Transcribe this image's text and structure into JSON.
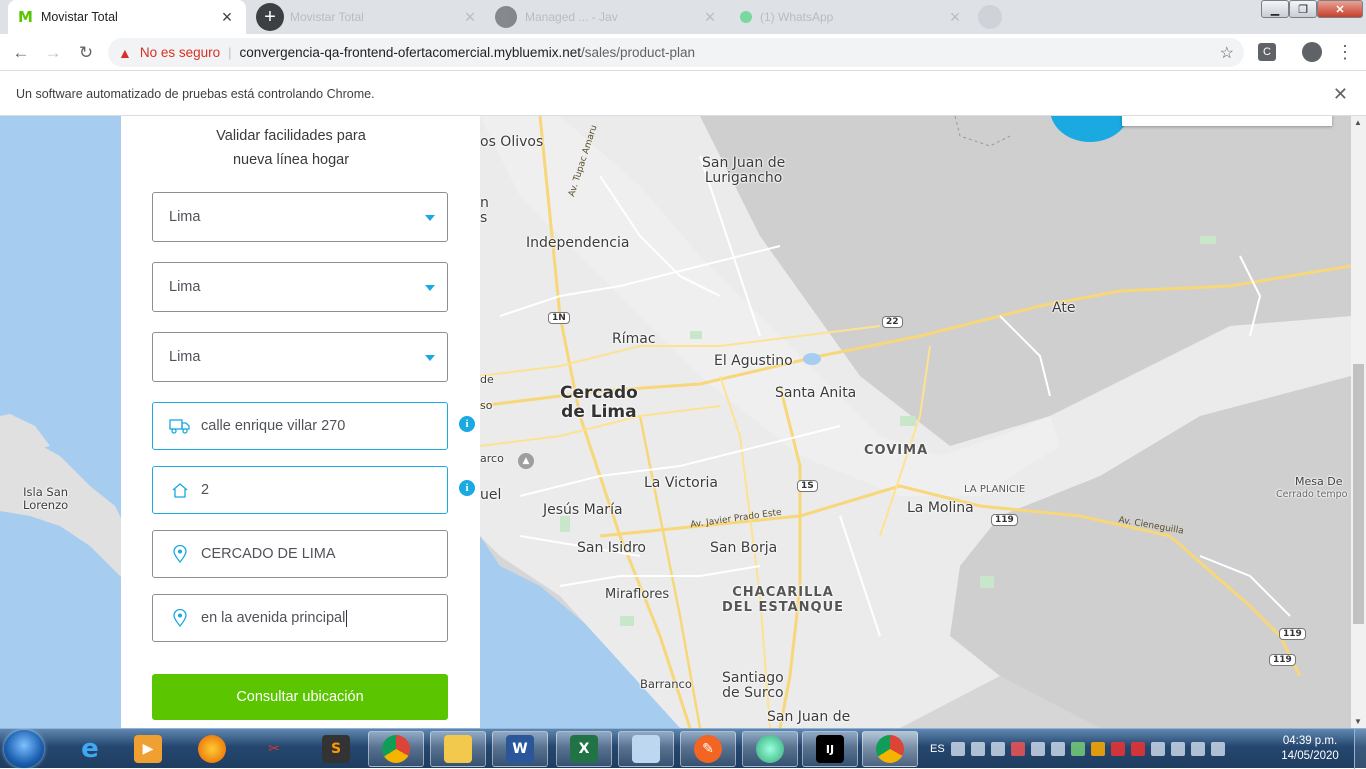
{
  "browser": {
    "tabs": [
      {
        "title": "Movistar Total",
        "active": true
      },
      {
        "title": "Movistar Total",
        "active": false
      },
      {
        "title": "Managed ... - Jav",
        "active": false
      },
      {
        "title": "(1) WhatsApp",
        "active": false
      }
    ],
    "security_label": "No es seguro",
    "url_host": "convergencia-qa-frontend-ofertacomercial.mybluemix.net",
    "url_path": "/sales/product-plan",
    "infobar_text": "Un software automatizado de pruebas está controlando Chrome.",
    "extension_letter": "C",
    "colors": {
      "tabbar": "#dee1e6",
      "insecure": "#d93025"
    }
  },
  "form": {
    "title_line1": "Validar facilidades para",
    "title_line2": "nueva línea hogar",
    "department": "Lima",
    "province": "Lima",
    "district": "Lima",
    "address": "calle enrique villar 270",
    "number": "2",
    "district_ref": "CERCADO DE LIMA",
    "reference": "en la avenida principal",
    "submit_label": "Consultar ubicación",
    "colors": {
      "accent": "#1aa9e0",
      "submit": "#5bc500"
    }
  },
  "map": {
    "labels": {
      "los_olivos": "os Olivos",
      "sjl1": "San Juan de",
      "sjl2": "Lurigancho",
      "independencia": "Independencia",
      "rimac": "Rímac",
      "el_agustino": "El Agustino",
      "ate": "Ate",
      "cercado1": "Cercado",
      "cercado2": "de Lima",
      "santa_anita": "Santa Anita",
      "covima": "COVIMA",
      "la_planicie": "LA PLANICIE",
      "la_victoria": "La Victoria",
      "isla1": "Isla San",
      "isla2": "Lorenzo",
      "jesus_maria": "Jesús María",
      "la_molina": "La Molina",
      "mesa1": "Mesa De",
      "mesa2": "Cerrado tempo",
      "san_isidro": "San Isidro",
      "san_borja": "San Borja",
      "chacarilla1": "CHACARILLA",
      "chacarilla2": "DEL ESTANQUE",
      "miraflores": "Miraflores",
      "barranco": "Barranco",
      "surco1": "Santiago",
      "surco2": "de Surco",
      "sjm": "San Juan de",
      "parque": "arco",
      "uel": "uel",
      "de": "de",
      "so": "so",
      "n": "n",
      "s": "s"
    },
    "roads": {
      "tupac": "Av. Tupac Amaru",
      "javier_prado": "Av. Javier Prado Este",
      "cieneguilla": "Av. Cieneguilla"
    },
    "shields": {
      "r1n": "1N",
      "r22": "22",
      "r1s": "1S",
      "r119a": "119",
      "r119b": "119",
      "r119c": "119"
    }
  },
  "taskbar": {
    "language": "ES",
    "time": "04:39 p.m.",
    "date": "14/05/2020",
    "apps": [
      "internet-explorer",
      "media-player",
      "firefox",
      "snipping-tool",
      "sublime-text",
      "chrome",
      "file-explorer",
      "word",
      "excel",
      "notepad",
      "paint-app",
      "network-app",
      "intellij",
      "chrome-active"
    ]
  }
}
